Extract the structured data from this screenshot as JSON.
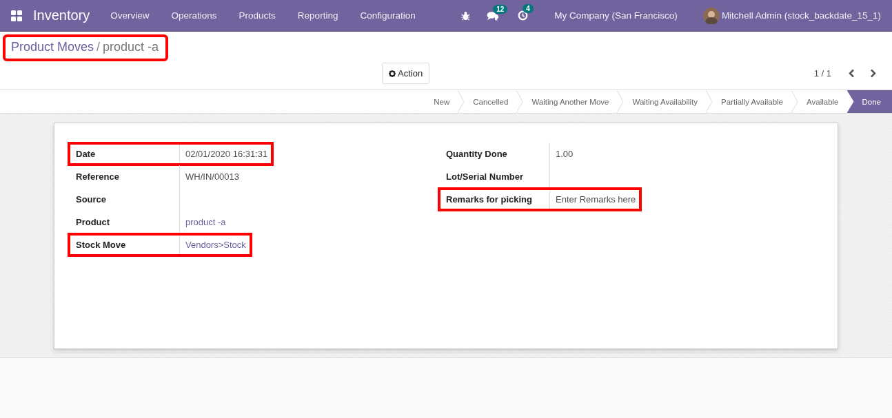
{
  "navbar": {
    "app_name": "Inventory",
    "menu": [
      {
        "label": "Overview"
      },
      {
        "label": "Operations"
      },
      {
        "label": "Products"
      },
      {
        "label": "Reporting"
      },
      {
        "label": "Configuration"
      }
    ],
    "messages_count": "12",
    "activities_count": "4",
    "company": "My Company (San Francisco)",
    "user": "Mitchell Admin (stock_backdate_15_1)"
  },
  "breadcrumb": {
    "items": [
      "Product Moves",
      "product -a"
    ],
    "separator": "/",
    "highlighted": true
  },
  "action_button": "Action",
  "pager": "1 / 1",
  "stages": [
    {
      "label": "New",
      "selected": false
    },
    {
      "label": "Cancelled",
      "selected": false
    },
    {
      "label": "Waiting Another Move",
      "selected": false
    },
    {
      "label": "Waiting Availability",
      "selected": false
    },
    {
      "label": "Partially Available",
      "selected": false
    },
    {
      "label": "Available",
      "selected": false
    },
    {
      "label": "Done",
      "selected": true
    }
  ],
  "left_fields": [
    {
      "label": "Date",
      "value": "02/01/2020 16:31:31",
      "kind": "text",
      "highlighted": true
    },
    {
      "label": "Reference",
      "value": "WH/IN/00013",
      "kind": "text",
      "highlighted": false
    },
    {
      "label": "Source",
      "highlighted": false
    },
    {
      "label": "Product",
      "value": "product -a",
      "kind": "link",
      "highlighted": false
    },
    {
      "label": "Stock Move",
      "value": "Vendors>Stock",
      "kind": "link",
      "highlighted": true
    }
  ],
  "right_fields": [
    {
      "label": "Quantity Done",
      "value": "1.00",
      "highlighted": false
    },
    {
      "label": "Lot/Serial Number",
      "highlighted": false
    },
    {
      "label": "Remarks for picking",
      "value": "Enter Remarks here",
      "highlighted": true
    }
  ]
}
